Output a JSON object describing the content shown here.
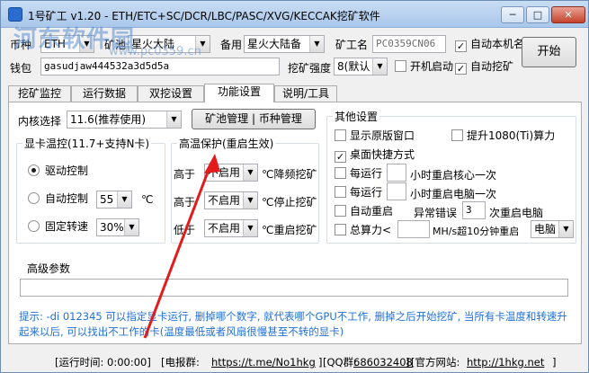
{
  "window": {
    "title": "1号矿工 v1.20 - ETH/ETC+SC/DCR/LBC/PASC/XVG/KECCAK挖矿软件",
    "min_glyph": "─",
    "max_glyph": "□",
    "close_glyph": "✕"
  },
  "watermark": {
    "text": "河东软件园",
    "url": "www.pc0359.cn"
  },
  "top": {
    "coin_label": "币种",
    "coin_value": "ETH",
    "pool_label": "矿池",
    "pool_value": "星火大陆",
    "backup_label": "备用",
    "backup_value": "星火大陆备",
    "worker_label": "矿工名",
    "worker_value": "PC0359CN06",
    "auto_worker_label": "自动本机名",
    "wallet_label": "钱包",
    "wallet_value": "gasudjaw444532a3d5d5a",
    "intensity_label": "挖矿强度",
    "intensity_value": "8(默认",
    "startup_label": "开机启动",
    "auto_mine_label": "自动挖矿",
    "start_button": "开始"
  },
  "tabs": [
    "挖矿监控",
    "运行数据",
    "双挖设置",
    "功能设置",
    "说明/工具"
  ],
  "settings": {
    "kernel_label": "内核选择",
    "kernel_value": "11.6(推荐使用)",
    "pool_manage_button": "矿池管理 | 币种管理",
    "gpu_temp": {
      "title": "显卡温控(11.7+支持N卡)",
      "driver_label": "驱动控制",
      "auto_label": "自动控制",
      "auto_value": "55",
      "unit": "℃",
      "fixed_label": "固定转速",
      "fixed_value": "30%"
    },
    "high_temp": {
      "title": "高温保护(重启生效)",
      "row1_prefix": "高于",
      "row1_value": "不启用",
      "row1_suffix": "℃降频挖矿",
      "row2_prefix": "高于",
      "row2_value": "不启用",
      "row2_suffix": "℃停止挖矿",
      "row3_prefix": "低于",
      "row3_value": "不启用",
      "row3_suffix": "℃重启挖矿"
    },
    "other": {
      "title": "其他设置",
      "show_window": "显示原版窗口",
      "boost_1080": "提升1080(Ti)算力",
      "desktop_shortcut": "桌面快捷方式",
      "every1_prefix": "每运行",
      "every1_suffix": "小时重启核心一次",
      "every2_prefix": "每运行",
      "every2_suffix": "小时重启电脑一次",
      "auto_restart": "自动重启",
      "error_label": "异常错误",
      "error_value": "3",
      "error_suffix": "次重启电脑",
      "hashrate_prefix": "总算力<",
      "hashrate_suffix": "MH/s超10分钟重启",
      "restart_target": "电脑"
    },
    "advanced_label": "高级参数",
    "hint": "提示: -di 012345 可以指定显卡运行, 删掉哪个数字, 就代表哪个GPU不工作, 删掉之后开始挖矿, 当所有卡温度和转速升起来以后, 可以找出不工作的卡(温度最低或者风扇很慢甚至不转的显卡)"
  },
  "status": {
    "runtime": "[运行时间: 0:00:00]",
    "telegram_prefix": "[电报群:",
    "telegram_link": "https://t.me/No1hkg",
    "telegram_suffix": "]",
    "qq_prefix": "[QQ群:",
    "qq_link": "686032408",
    "qq_suffix": "]",
    "website_prefix": "[官方网站:",
    "website_link": "http://1hkg.net",
    "website_suffix": "]"
  }
}
